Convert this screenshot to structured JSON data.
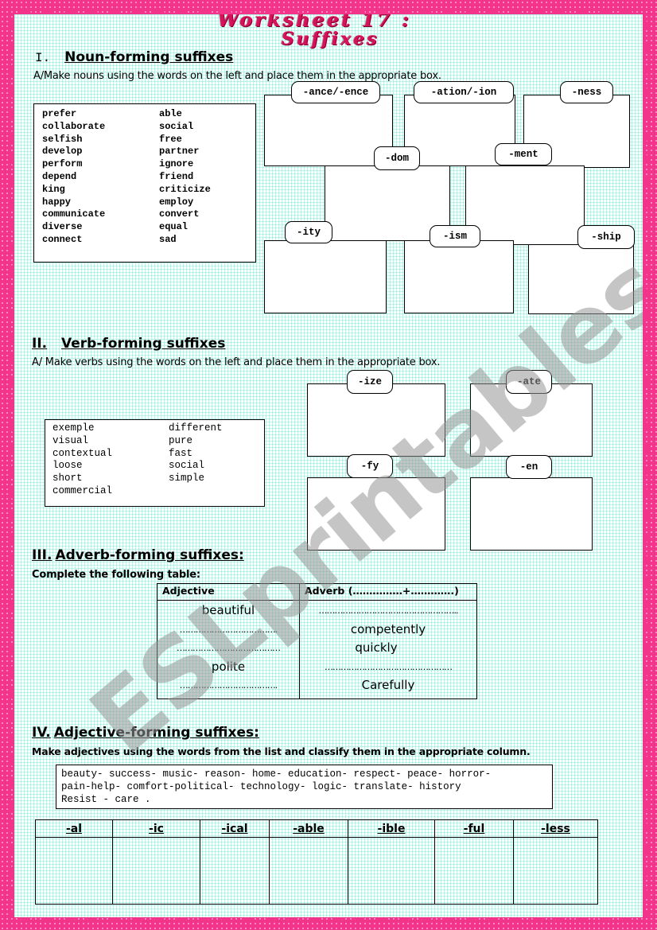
{
  "title": {
    "line1": "Worksheet 17 :",
    "line2": "Suffixes"
  },
  "section1": {
    "number": "I.",
    "heading": "Noun-forming suffixes",
    "instruction": "A/Make nouns using the words on the left and place them in the appropriate box.",
    "words_left": [
      "prefer",
      "collaborate",
      "selfish",
      "develop",
      "perform",
      "depend",
      "king",
      "happy",
      "communicate",
      "diverse",
      "connect"
    ],
    "words_right": [
      "able",
      "social",
      "free",
      "partner",
      "ignore",
      "friend",
      "criticize",
      "employ",
      "convert",
      "equal",
      "sad"
    ],
    "suffix_boxes": {
      "ance": "-ance/-ence",
      "ation": "-ation/-ion",
      "ness": "-ness",
      "dom": "-dom",
      "ment": "-ment",
      "ity": "-ity",
      "ism": "-ism",
      "ship": "-ship"
    }
  },
  "section2": {
    "number": "II.",
    "heading": "Verb-forming suffixes",
    "instruction": "A/ Make verbs using the words on the left and place them in the appropriate box.",
    "words_left": [
      "exemple",
      "visual",
      "contextual",
      "loose",
      "short",
      "commercial"
    ],
    "words_right": [
      "different",
      "pure",
      "fast",
      "social",
      "simple"
    ],
    "suffix_boxes": {
      "ize": "-ize",
      "ate": "-ate",
      "fy": "-fy",
      "en": "-en"
    }
  },
  "section3": {
    "number": "III.",
    "heading": "Adverb-forming suffixes:",
    "instruction": "Complete the following table:",
    "table": {
      "headers": [
        "Adjective",
        "Adverb (……………+………….)"
      ],
      "adjectives": [
        "beautiful",
        "……………………………….",
        "…………………………………",
        "polite",
        "………………………………."
      ],
      "adverbs": [
        "……………………………………………..",
        "competently",
        "quickly",
        "…………………………………………",
        "Carefully"
      ]
    }
  },
  "section4": {
    "number": "IV.",
    "heading": "Adjective-forming suffixes:",
    "instruction": "Make adjectives using the words from the list and classify them in the appropriate column.",
    "word_list": [
      "beauty- success- music- reason- home- education- respect- peace- horror-",
      "pain-help- comfort-political- technology- logic- translate- history",
      "Resist - care ."
    ],
    "columns": [
      "-al",
      "-ic",
      "-ical",
      "-able",
      "-ible",
      "-ful",
      "-less"
    ]
  },
  "watermark": "ESLprintables.com"
}
